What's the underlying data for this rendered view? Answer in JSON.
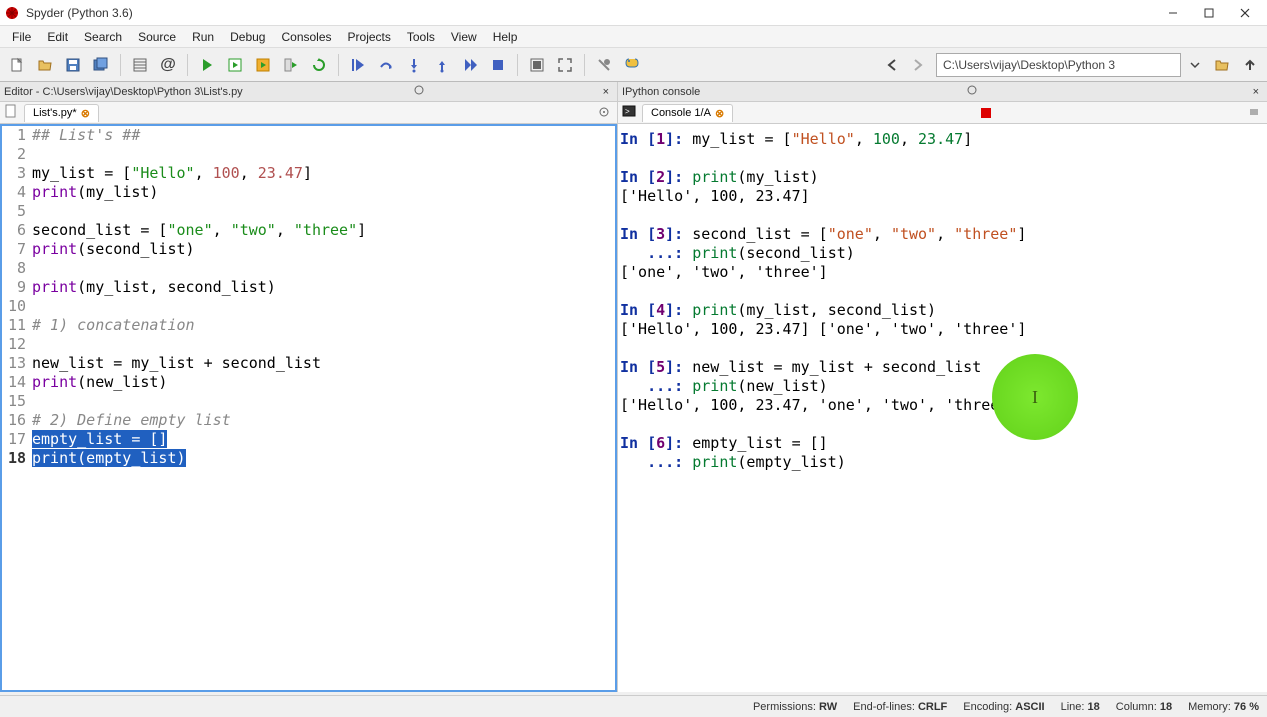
{
  "window": {
    "title": "Spyder (Python 3.6)"
  },
  "menu": {
    "items": [
      "File",
      "Edit",
      "Search",
      "Source",
      "Run",
      "Debug",
      "Consoles",
      "Projects",
      "Tools",
      "View",
      "Help"
    ]
  },
  "toolbar": {
    "path": "C:\\Users\\vijay\\Desktop\\Python 3"
  },
  "panes": {
    "editor_title": "Editor - C:\\Users\\vijay\\Desktop\\Python 3\\List's.py",
    "console_title": "IPython console"
  },
  "editor_tab": {
    "label": "List's.py*"
  },
  "console_tab": {
    "label": "Console 1/A"
  },
  "editor_lines": {
    "l1": "## List's ##",
    "l3a": "my_list = [",
    "l3b": "\"Hello\"",
    "l3c": ", ",
    "l3d": "100",
    "l3e": ", ",
    "l3f": "23.47",
    "l3g": "]",
    "l4a": "print",
    "l4b": "(my_list)",
    "l6a": "second_list = [",
    "l6b": "\"one\"",
    "l6c": ", ",
    "l6d": "\"two\"",
    "l6e": ", ",
    "l6f": "\"three\"",
    "l6g": "]",
    "l7a": "print",
    "l7b": "(second_list)",
    "l9a": "print",
    "l9b": "(my_list, second_list)",
    "l11": "# 1) concatenation",
    "l13": "new_list = my_list + second_list",
    "l14a": "print",
    "l14b": "(new_list)",
    "l16": "# 2) Define empty list",
    "l17": "empty_list = []",
    "l18a": "print",
    "l18b": "(empty_list)"
  },
  "console": {
    "in1_pre": "In [",
    "in1_n": "1",
    "in1_post": "]: ",
    "in1_code_a": "my_list = [",
    "in1_code_b": "\"Hello\"",
    "in1_code_c": ", ",
    "in1_code_d": "100",
    "in1_code_e": ", ",
    "in1_code_f": "23.47",
    "in1_code_g": "]",
    "in2_n": "2",
    "in2_code": "print(my_list)",
    "in2_code_fn": "print",
    "in2_code_rest": "(my_list)",
    "out2": "['Hello', 100, 23.47]",
    "in3_n": "3",
    "in3_code_a": "second_list = [",
    "in3_code_b": "\"one\"",
    "in3_code_d": "\"two\"",
    "in3_code_f": "\"three\"",
    "in3_code_g": "]",
    "cont": "   ...: ",
    "in3b_fn": "print",
    "in3b_rest": "(second_list)",
    "out3": "['one', 'two', 'three']",
    "in4_n": "4",
    "in4_fn": "print",
    "in4_rest": "(my_list, second_list)",
    "out4": "['Hello', 100, 23.47] ['one', 'two', 'three']",
    "in5_n": "5",
    "in5_code": "new_list = my_list + second_list",
    "in5b_fn": "print",
    "in5b_rest": "(new_list)",
    "out5": "['Hello', 100, 23.47, 'one', 'two', 'three']",
    "in6_n": "6",
    "in6_code": "empty_list = []",
    "in6b_fn": "print",
    "in6b_rest": "(empty_list)"
  },
  "status": {
    "perm_label": "Permissions:",
    "perm_val": "RW",
    "eol_label": "End-of-lines:",
    "eol_val": "CRLF",
    "enc_label": "Encoding:",
    "enc_val": "ASCII",
    "line_label": "Line:",
    "line_val": "18",
    "col_label": "Column:",
    "col_val": "18",
    "mem_label": "Memory:",
    "mem_val": "76 %"
  },
  "marker": {
    "char": "I"
  }
}
